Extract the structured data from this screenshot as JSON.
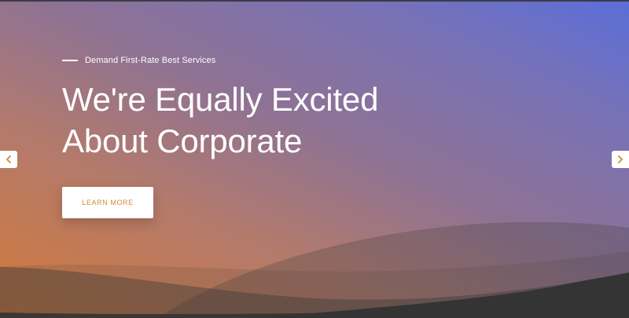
{
  "hero": {
    "eyebrow": "Demand First-Rate Best Services",
    "headline_line1": "We're Equally Excited",
    "headline_line2": "About Corporate",
    "cta_label": "LEARN MORE"
  },
  "carousel": {
    "prev_icon": "chevron-left-icon",
    "next_icon": "chevron-right-icon"
  },
  "colors": {
    "gradient_top_right": "#5a6ed8",
    "gradient_bottom_left": "#d37a3a",
    "wave_dark": "#363636",
    "accent": "#d38a3a",
    "text": "#ffffff"
  }
}
